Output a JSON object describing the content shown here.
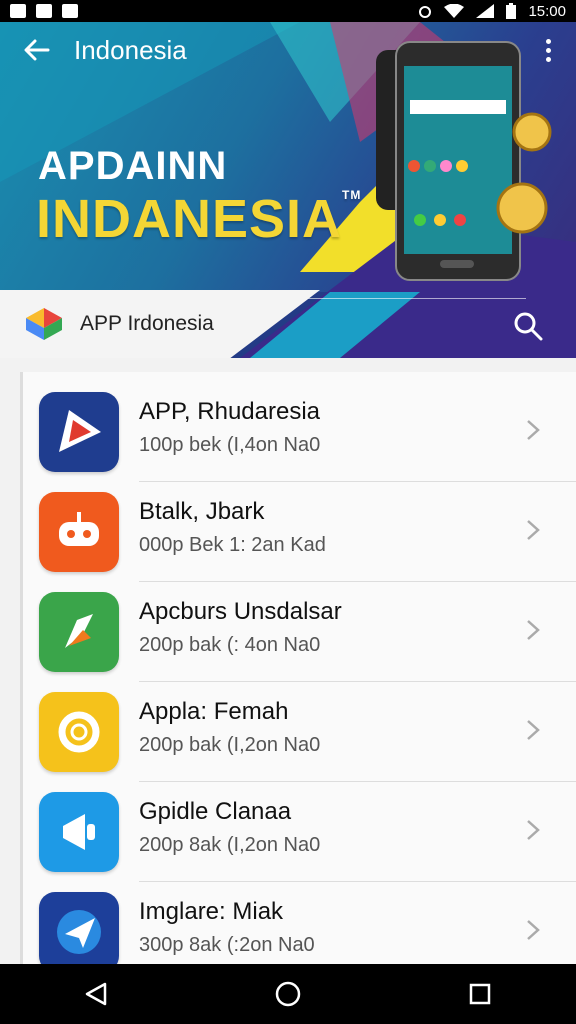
{
  "status": {
    "time": "15:00"
  },
  "topbar": {
    "title": "Indonesia"
  },
  "hero": {
    "brand_line1": "APDAINN",
    "brand_line2": "INDANESIA",
    "tm": "TM"
  },
  "search": {
    "label": "APP Irdonesia"
  },
  "apps": [
    {
      "name": "APP, Rhudaresia",
      "meta": "100p bek (I,4on Na0",
      "color": "#1f3d8f",
      "icon": "triangle-play-icon"
    },
    {
      "name": "Btalk, Jbark",
      "meta": "000p Bek 1: 2an Kad",
      "color": "#f05a1e",
      "icon": "robot-icon"
    },
    {
      "name": "Apcburs Unsdalsar",
      "meta": "200p bak (: 4on Na0",
      "color": "#3aa54a",
      "icon": "arrow-leaf-icon"
    },
    {
      "name": "Appla: Femah",
      "meta": "200p bak (I,2on Na0",
      "color": "#f5c21b",
      "icon": "gear-ring-icon"
    },
    {
      "name": "Gpidle Clanaa",
      "meta": "200p 8ak (I,2on Na0",
      "color": "#1e9ae6",
      "icon": "megaphone-icon"
    },
    {
      "name": "Imglare: Miak",
      "meta": "300p 8ak (:2on Na0",
      "color": "#1d3f9a",
      "icon": "paper-plane-icon"
    }
  ]
}
